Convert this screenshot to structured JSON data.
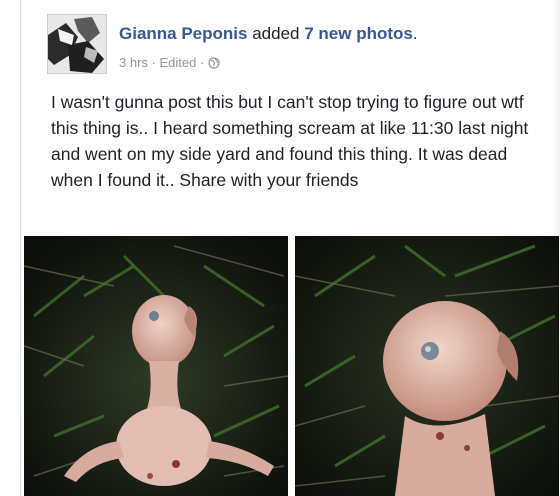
{
  "post": {
    "author": "Gianna Peponis",
    "action": "added",
    "photo_count_label": "7 new photos",
    "timestamp": "3 hrs",
    "edited_label": "Edited",
    "privacy_icon": "globe-icon",
    "text": "I wasn't gunna post this but I can't stop trying to figure out wtf this thing is.. I heard something scream at like 11:30 last night and went on my side yard and found this thing. It was dead when I found it.. Share with your friends"
  },
  "colors": {
    "link": "#365899",
    "meta": "#90949c",
    "text": "#1d2129"
  }
}
